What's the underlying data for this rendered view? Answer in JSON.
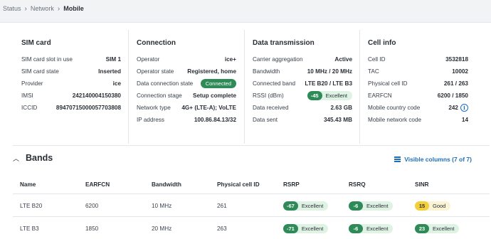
{
  "breadcrumb": {
    "items": [
      "Status",
      "Network",
      "Mobile"
    ]
  },
  "sim_card": {
    "title": "SIM card",
    "rows": [
      {
        "k": "SIM card slot in use",
        "v": "SIM 1"
      },
      {
        "k": "SIM card state",
        "v": "Inserted"
      },
      {
        "k": "Provider",
        "v": "ice"
      },
      {
        "k": "IMSI",
        "v": "242140004150380"
      },
      {
        "k": "ICCID",
        "v": "89470715000057703808"
      }
    ]
  },
  "connection": {
    "title": "Connection",
    "rows": [
      {
        "k": "Operator",
        "v": "ice+"
      },
      {
        "k": "Operator state",
        "v": "Registered, home"
      },
      {
        "k": "Data connection state",
        "v": "Connected"
      },
      {
        "k": "Connection stage",
        "v": "Setup complete"
      },
      {
        "k": "Network type",
        "v": "4G+ (LTE-A); VoLTE"
      },
      {
        "k": "IP address",
        "v": "100.86.84.13/32"
      }
    ]
  },
  "data_transmission": {
    "title": "Data transmission",
    "rows": [
      {
        "k": "Carrier aggregation",
        "v": "Active"
      },
      {
        "k": "Bandwidth",
        "v": "10 MHz / 20 MHz"
      },
      {
        "k": "Connected band",
        "v": "LTE B20 / LTE B3"
      },
      {
        "k": "RSSI (dBm)",
        "n": "-45",
        "q": "Excellent"
      },
      {
        "k": "Data received",
        "v": "2.63 GB"
      },
      {
        "k": "Data sent",
        "v": "345.43 MB"
      }
    ]
  },
  "cell_info": {
    "title": "Cell info",
    "rows": [
      {
        "k": "Cell ID",
        "v": "3532818"
      },
      {
        "k": "TAC",
        "v": "10002"
      },
      {
        "k": "Physical cell ID",
        "v": "261 / 263"
      },
      {
        "k": "EARFCN",
        "v": "6200 / 1850"
      },
      {
        "k": "Mobile country code",
        "v": "242"
      },
      {
        "k": "Mobile network code",
        "v": "14"
      }
    ]
  },
  "bands": {
    "title": "Bands",
    "visible_columns": "Visible columns (7 of 7)",
    "columns": [
      "Name",
      "EARFCN",
      "Bandwidth",
      "Physical cell ID",
      "RSRP",
      "RSRQ",
      "SINR"
    ],
    "rows": [
      {
        "name": "LTE B20",
        "earfcn": "6200",
        "bandwidth": "10 MHz",
        "pci": "261",
        "rsrp": {
          "n": "-67",
          "q": "Excellent"
        },
        "rsrq": {
          "n": "-6",
          "q": "Excellent"
        },
        "sinr": {
          "n": "15",
          "q": "Good"
        }
      },
      {
        "name": "LTE B3",
        "earfcn": "1850",
        "bandwidth": "20 MHz",
        "pci": "263",
        "rsrp": {
          "n": "-71",
          "q": "Excellent"
        },
        "rsrq": {
          "n": "-6",
          "q": "Excellent"
        },
        "sinr": {
          "n": "23",
          "q": "Excellent"
        }
      }
    ]
  },
  "colors": {
    "accent": "#1e6fb8",
    "excellent": "#2e8b57",
    "good": "#f3cf3a"
  }
}
